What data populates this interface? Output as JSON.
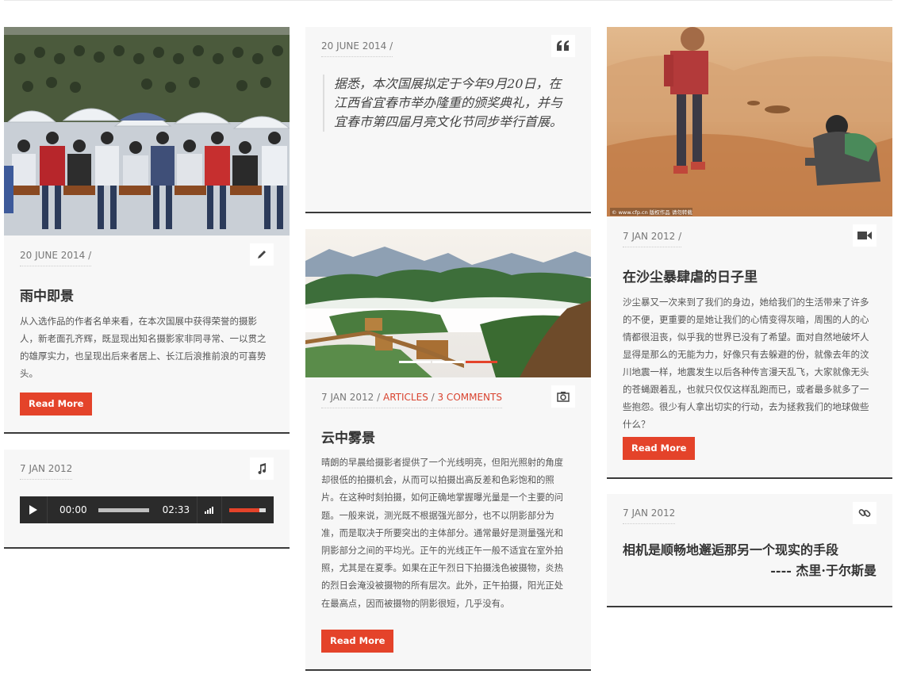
{
  "posts": {
    "p1": {
      "date": "20 JUNE 2014 /",
      "title": "雨中即景",
      "excerpt": "从入选作品的作者名单来看，在本次国展中获得荣誉的摄影人，新老面孔齐辉，既显现出知名摄影家非同寻常、一以贯之的雄厚实力，也呈现出后来者居上、长江后浪推前浪的可喜势头。",
      "read_more": "Read More",
      "format_icon": "pencil-icon"
    },
    "p2": {
      "date": "7 JAN 2012",
      "format_icon": "music-icon",
      "audio": {
        "current": "00:00",
        "duration": "02:33"
      }
    },
    "p3": {
      "date": "20 JUNE 2014 /",
      "quote": "据悉，本次国展拟定于今年9月20日，在江西省宜春市举办隆重的颁奖典礼，并与宜春市第四届月亮文化节同步举行首展。",
      "format_icon": "quote-icon"
    },
    "p4": {
      "date": "7 JAN 2012 / ",
      "category": "ARTICLES",
      "sep": " / ",
      "comments": "3 COMMENTS",
      "title": "云中雾景",
      "excerpt": "晴朗的早晨给摄影者提供了一个光线明亮，但阳光照射的角度却很低的拍摄机会，从而可以拍摄出高反差和色彩饱和的照片。在这种时刻拍摄，如何正确地掌握曝光量是一个主要的问题。一般来说，测光既不根据强光部分，也不以阴影部分为准，而是取决于所要突出的主体部分。通常最好是测量强光和阴影部分之间的平均光。正午的光线正午一般不适宜在室外拍照，尤其是在夏季。如果在正午烈日下拍摄浅色被摄物，炎热的烈日会淹没被摄物的所有层次。此外，正午拍摄，阳光正处在最高点，因而被摄物的阴影很短，几乎没有。",
      "read_more": "Read More",
      "format_icon": "camera-icon"
    },
    "p5": {
      "date": "7 JAN 2012 /",
      "title": "在沙尘暴肆虐的日子里",
      "excerpt": "沙尘暴又一次来到了我们的身边，她给我们的生活带来了许多的不便，更重要的是她让我们的心情变得灰暗，周围的人的心情都很沮丧，似乎我的世界已没有了希望。面对自然地破坏人显得是那么的无能为力，好像只有去躲避的份，就像去年的汶川地震一样，地震发生以后各种传言漫天乱飞，大家就像无头的苍蝇跟着乱，也就只仅仅这样乱跑而已，或者最多就多了一些抱怨。很少有人拿出切实的行动，去为拯救我们的地球做些什么？",
      "read_more": "Read More",
      "format_icon": "video-icon",
      "watermark": "© www.cfp.cn 版权作品 请勿转载"
    },
    "p6": {
      "date": "7 JAN 2012",
      "quote": "相机是顺畅地邂逅那另一个现实的手段",
      "author": "---- 杰里·于尔斯曼",
      "format_icon": "link-icon"
    }
  },
  "colors": {
    "accent": "#e4432a",
    "card_bg": "#f7f7f7",
    "border": "#3a3a3a"
  }
}
